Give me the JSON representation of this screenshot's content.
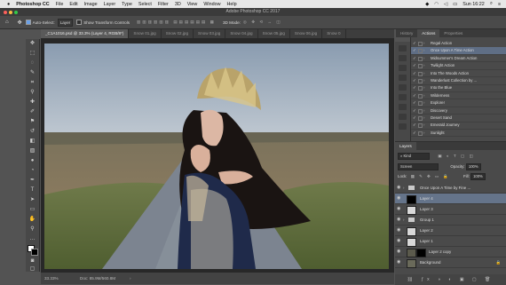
{
  "menubar": {
    "apple": "",
    "items": [
      "Photoshop CC",
      "File",
      "Edit",
      "Image",
      "Layer",
      "Type",
      "Select",
      "Filter",
      "3D",
      "View",
      "Window",
      "Help"
    ],
    "clock": "Sun 16:22"
  },
  "window": {
    "title": "Adobe Photoshop CC 2017"
  },
  "options": {
    "auto_select_label": "Auto-Select:",
    "auto_select_value": "Layer",
    "transform_label": "Show Transform Controls",
    "mode_label": "3D Mode:"
  },
  "tabs": [
    {
      "label": "_C1A1016.psd @ 33.3% (Layer 4, RGB/8*)",
      "active": true
    },
    {
      "label": "Snow 01.jpg",
      "active": false
    },
    {
      "label": "Snow 02.jpg",
      "active": false
    },
    {
      "label": "Snow 03.jpg",
      "active": false
    },
    {
      "label": "Snow 04.jpg",
      "active": false
    },
    {
      "label": "Snow 05.jpg",
      "active": false
    },
    {
      "label": "Snow 06.jpg",
      "active": false
    },
    {
      "label": "Snow 0",
      "active": false
    }
  ],
  "status": {
    "zoom": "33.33%",
    "doc": "Doc: 85.9M/560.8M"
  },
  "actions_panel": {
    "tabs": [
      "History",
      "Actions",
      "Properties"
    ],
    "active_tab": "Actions",
    "items": [
      {
        "label": "Regal Action",
        "selected": false
      },
      {
        "label": "Once Upon A Time Action",
        "selected": true
      },
      {
        "label": "Midsummer's Dream Action",
        "selected": false
      },
      {
        "label": "Twilight Action",
        "selected": false
      },
      {
        "label": "Into The Woods Action",
        "selected": false
      },
      {
        "label": "Wanderlust Collection by ...",
        "selected": false
      },
      {
        "label": "Into the Blue",
        "selected": false
      },
      {
        "label": "Wilderness",
        "selected": false
      },
      {
        "label": "Explorer",
        "selected": false
      },
      {
        "label": "Discovery",
        "selected": false
      },
      {
        "label": "Desert Sand",
        "selected": false
      },
      {
        "label": "Emerald Journey",
        "selected": false
      },
      {
        "label": "Sunlight",
        "selected": false
      }
    ]
  },
  "layers_panel": {
    "title": "Layers",
    "filter_label": "Kind",
    "blend_mode": "Screen",
    "opacity_label": "Opacity:",
    "opacity_value": "100%",
    "lock_label": "Lock:",
    "fill_label": "Fill:",
    "fill_value": "100%",
    "layers": [
      {
        "name": "Once Upon A Time by Fine ...",
        "kind": "folder",
        "selected": false
      },
      {
        "name": "Layer 4",
        "kind": "dark",
        "selected": true
      },
      {
        "name": "Layer 3",
        "kind": "light",
        "selected": false
      },
      {
        "name": "Group 1",
        "kind": "folder",
        "selected": false
      },
      {
        "name": "Layer 2",
        "kind": "light",
        "selected": false
      },
      {
        "name": "Layer 1",
        "kind": "light",
        "selected": false
      },
      {
        "name": "Layer 2 copy",
        "kind": "photo-mask",
        "selected": false
      },
      {
        "name": "Background",
        "kind": "photo",
        "selected": false
      }
    ]
  },
  "colors": {
    "accent": "#65748a",
    "panel": "#4a4a4a",
    "canvas_bg": "#282828"
  }
}
